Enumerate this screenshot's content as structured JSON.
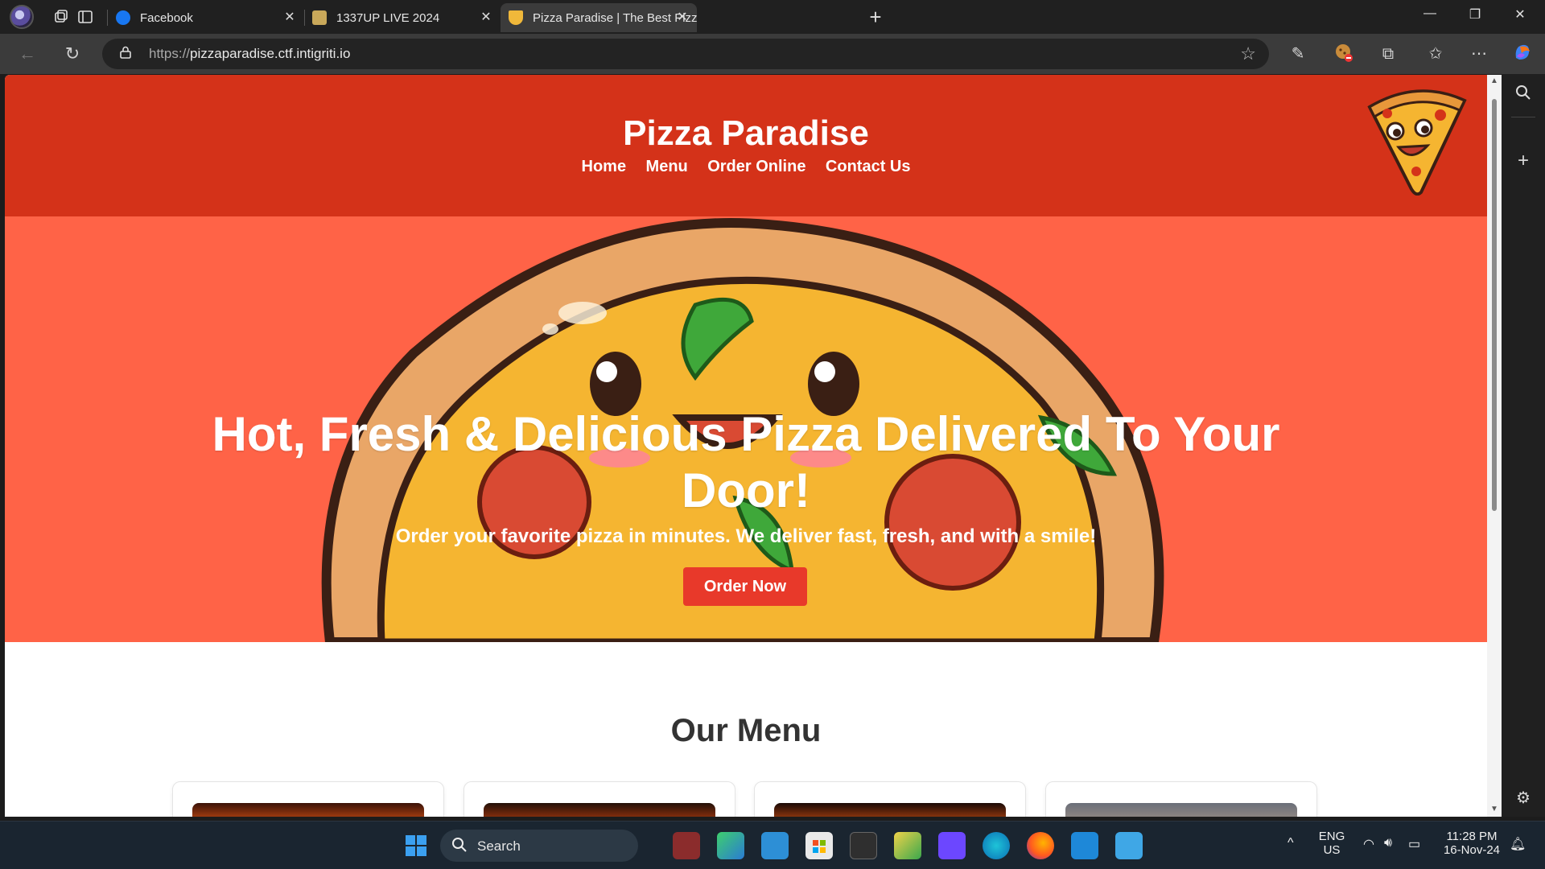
{
  "browser": {
    "tabs": [
      {
        "title": "Facebook",
        "active": false
      },
      {
        "title": "1337UP LIVE 2024",
        "active": false
      },
      {
        "title": "Pizza Paradise | The Best Pizza in T",
        "active": true
      }
    ],
    "url_proto": "https://",
    "url_host": "pizzaparadise.ctf.intigriti.io"
  },
  "site": {
    "title": "Pizza Paradise",
    "nav": [
      "Home",
      "Menu",
      "Order Online",
      "Contact Us"
    ],
    "hero_title": "Hot, Fresh & Delicious Pizza Delivered To Your Door!",
    "hero_subtitle": "Order your favorite pizza in minutes. We deliver fast, fresh, and with a smile!",
    "order_button": "Order Now",
    "menu_heading": "Our Menu"
  },
  "taskbar": {
    "search_label": "Search",
    "lang_line1": "ENG",
    "lang_line2": "US",
    "time": "11:28 PM",
    "date": "16-Nov-24"
  },
  "colors": {
    "header_red": "#d43219",
    "hero_tomato": "#ff6347",
    "button_red": "#e8392a"
  }
}
